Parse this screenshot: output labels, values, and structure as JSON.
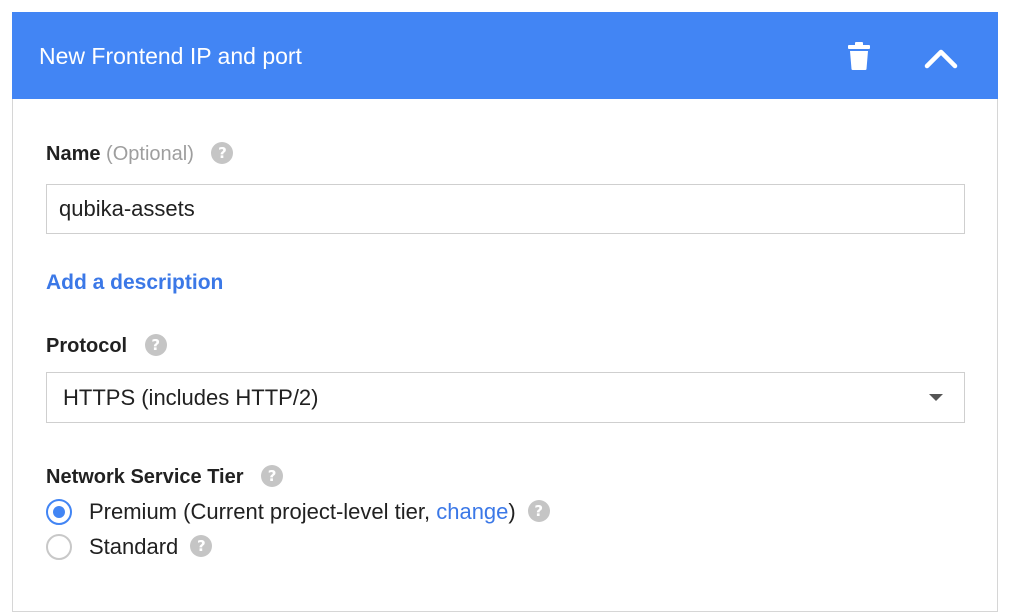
{
  "header": {
    "title": "New Frontend IP and port",
    "bg_color": "#4285f4",
    "delete_icon": "trash-icon",
    "collapse_icon": "chevron-up-icon"
  },
  "name_field": {
    "label": "Name",
    "optional_text": "(Optional)",
    "value": "qubika-assets",
    "help_icon": "help-icon"
  },
  "add_description_link": "Add a description",
  "protocol": {
    "label": "Protocol",
    "selected": "HTTPS (includes HTTP/2)",
    "help_icon": "help-icon"
  },
  "network_tier": {
    "label": "Network Service Tier",
    "options": [
      {
        "label_prefix": "Premium (Current project-level tier, ",
        "link": "change",
        "label_suffix": ")",
        "checked": true
      },
      {
        "label": "Standard",
        "checked": false
      }
    ]
  },
  "colors": {
    "accent": "#4285f4",
    "link": "#3b78e7",
    "help_icon_bg": "#c5c5c5"
  }
}
